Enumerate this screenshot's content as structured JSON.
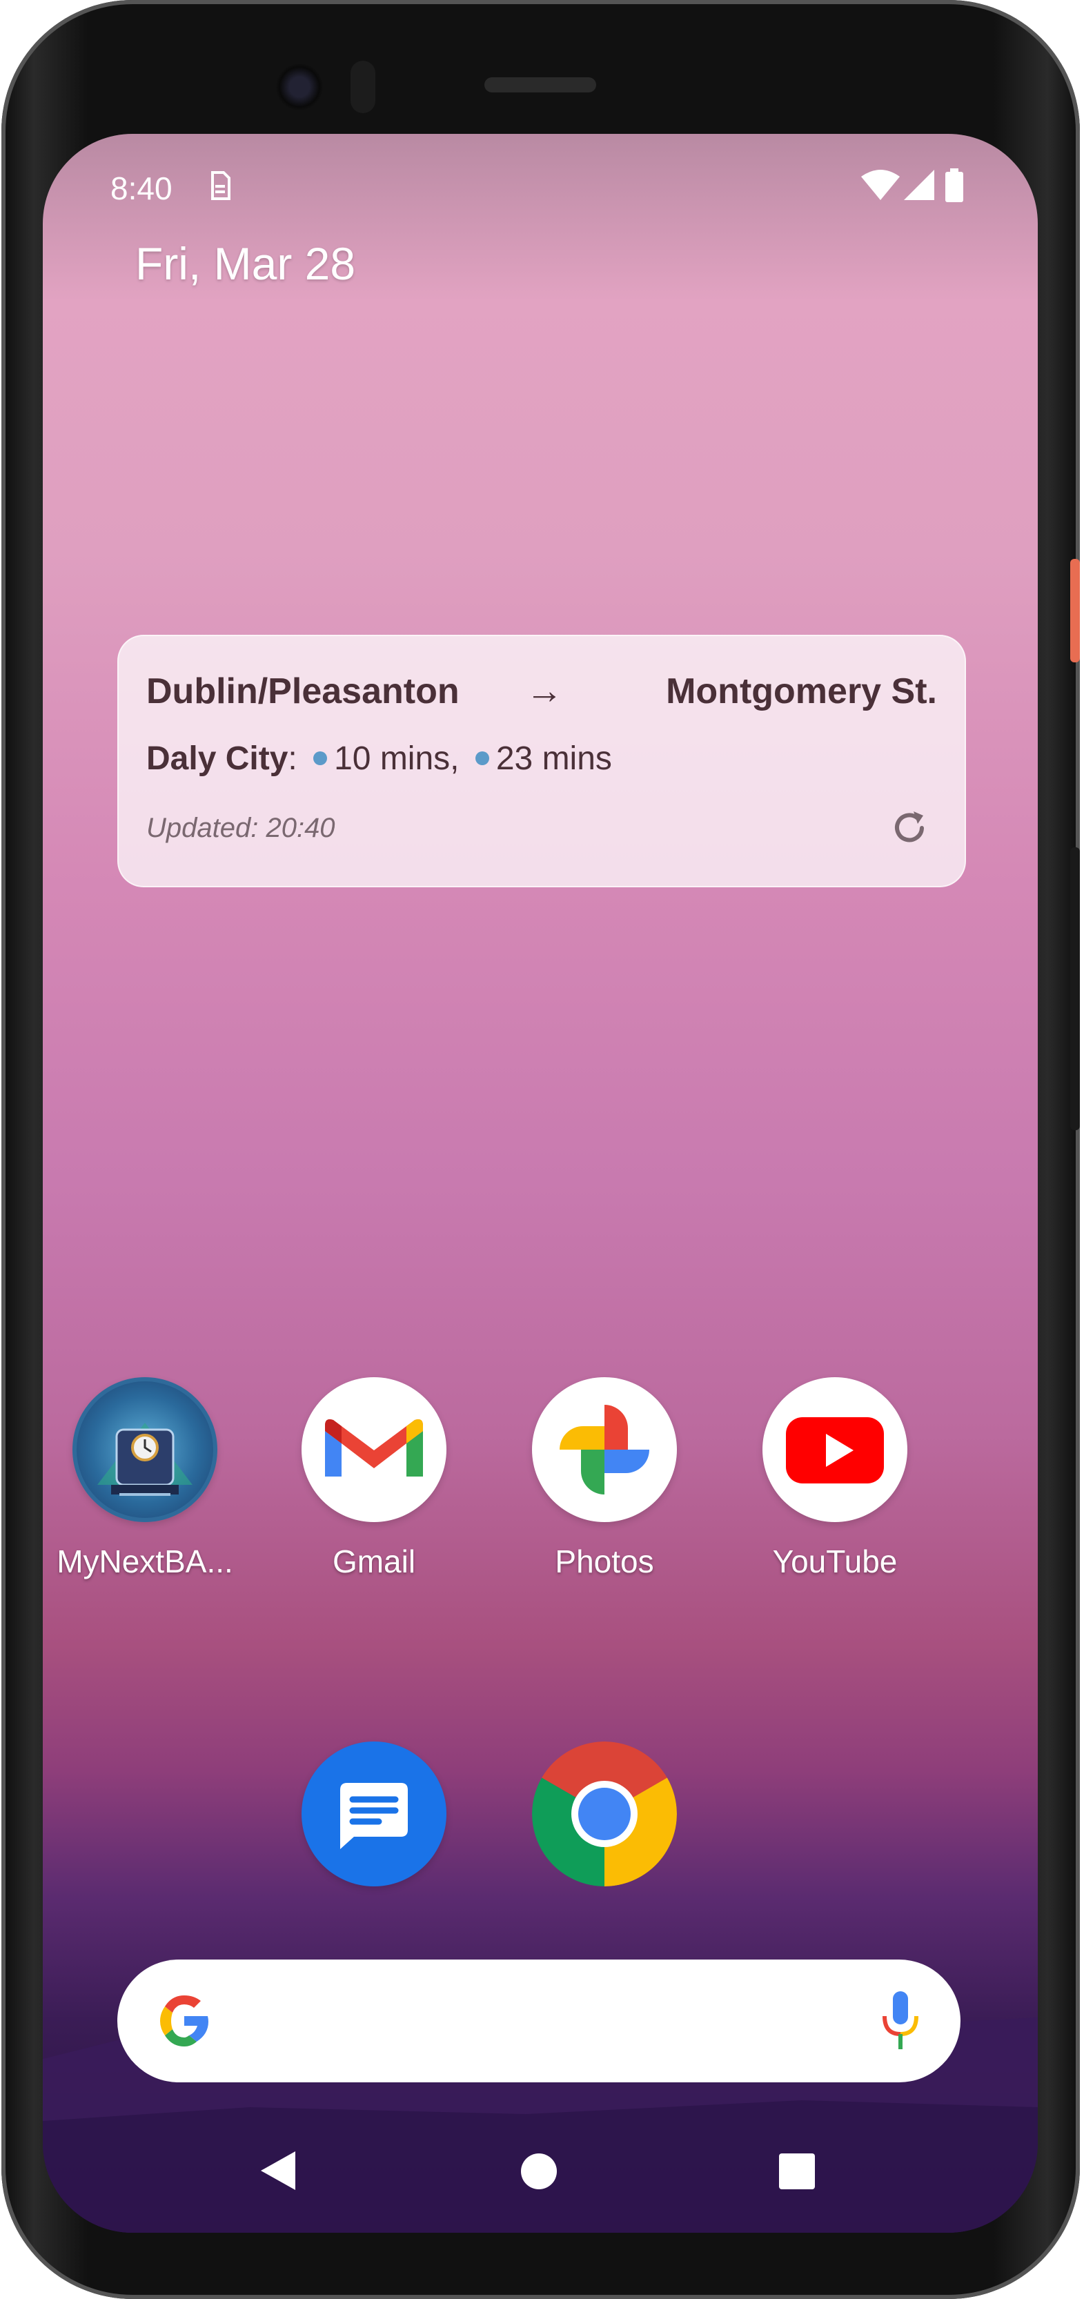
{
  "status_bar": {
    "time": "8:40",
    "icons": [
      "sim-icon",
      "wifi-icon",
      "signal-icon",
      "battery-icon"
    ]
  },
  "date": "Fri, Mar 28",
  "widget": {
    "from": "Dublin/Pleasanton",
    "arrow": "→",
    "to": "Montgomery St.",
    "destination": "Daly City",
    "separator": ":",
    "departure_1": "10 mins,",
    "departure_2": "23 mins",
    "updated": "Updated: 20:40",
    "dot_color": "#5b9ac9"
  },
  "apps": [
    {
      "label": "MyNextBA...",
      "icon": "train-clock-icon"
    },
    {
      "label": "Gmail",
      "icon": "gmail-icon"
    },
    {
      "label": "Photos",
      "icon": "photos-icon"
    },
    {
      "label": "YouTube",
      "icon": "youtube-icon"
    }
  ],
  "dock": [
    {
      "icon": "messages-icon"
    },
    {
      "icon": "chrome-icon"
    }
  ],
  "search_bar": {
    "left_icon": "google-g-icon",
    "right_icon": "mic-icon"
  },
  "nav": {
    "icons": [
      "back-icon",
      "home-icon",
      "recents-icon"
    ]
  },
  "colors": {
    "accent_orange": "#ec6a50",
    "youtube_red": "#ff0000",
    "messages_blue": "#1a73e8"
  }
}
